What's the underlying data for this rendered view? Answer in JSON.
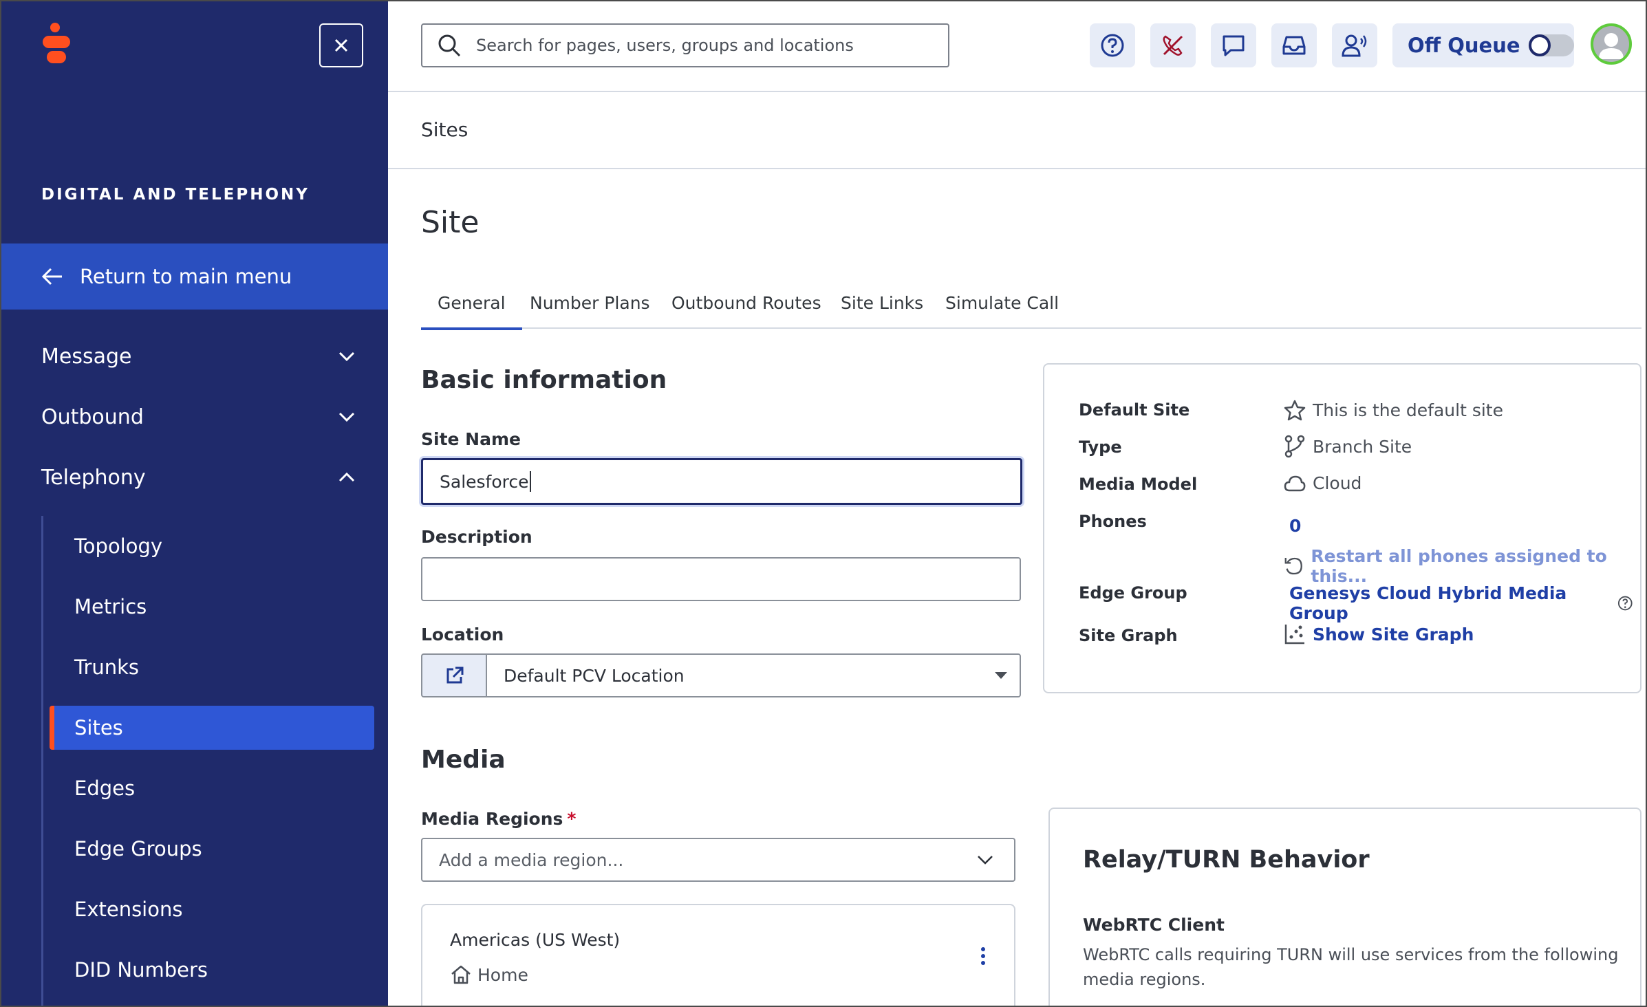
{
  "sidebar": {
    "section_title": "DIGITAL AND TELEPHONY",
    "return_label": "Return to main menu",
    "groups": [
      {
        "label": "Message",
        "expanded": false
      },
      {
        "label": "Outbound",
        "expanded": false
      },
      {
        "label": "Telephony",
        "expanded": true
      }
    ],
    "telephony_items": [
      {
        "label": "Topology"
      },
      {
        "label": "Metrics"
      },
      {
        "label": "Trunks"
      },
      {
        "label": "Sites",
        "active": true
      },
      {
        "label": "Edges"
      },
      {
        "label": "Edge Groups"
      },
      {
        "label": "Extensions"
      },
      {
        "label": "DID Numbers"
      }
    ]
  },
  "header": {
    "search_placeholder": "Search for pages, users, groups and locations",
    "queue_label": "Off Queue",
    "queue_on": false,
    "icons": [
      "help-icon",
      "phone-off-icon",
      "chat-icon",
      "inbox-icon",
      "user-voice-icon"
    ]
  },
  "breadcrumb": "Sites",
  "page_title": "Site",
  "tabs": [
    "General",
    "Number Plans",
    "Outbound Routes",
    "Site Links",
    "Simulate Call"
  ],
  "basic": {
    "heading": "Basic information",
    "site_name_label": "Site Name",
    "site_name_value": "Salesforce",
    "description_label": "Description",
    "description_value": "",
    "location_label": "Location",
    "location_value": "Default PCV Location"
  },
  "info": {
    "default_site_label": "Default Site",
    "default_site_value": "This is the default site",
    "type_label": "Type",
    "type_value": "Branch Site",
    "media_model_label": "Media Model",
    "media_model_value": "Cloud",
    "phones_label": "Phones",
    "phones_value": "0",
    "restart_link": "Restart all phones assigned to this...",
    "edge_group_label": "Edge Group",
    "edge_group_value": "Genesys Cloud Hybrid Media Group",
    "site_graph_label": "Site Graph",
    "site_graph_link": "Show Site Graph"
  },
  "media": {
    "heading": "Media",
    "regions_label": "Media Regions",
    "required_mark": "*",
    "regions_placeholder": "Add a media region...",
    "region_name": "Americas (US West)",
    "region_tag": "Home"
  },
  "turn": {
    "heading": "Relay/TURN Behavior",
    "client_label": "WebRTC Client",
    "client_desc_1": "WebRTC calls requiring TURN will use services from the following",
    "client_desc_2": "media regions."
  },
  "colors": {
    "sidebar_bg": "#1f2a6b",
    "accent": "#2a4fbf",
    "active_marker": "#ff4f1f",
    "link": "#1f3fa6"
  }
}
